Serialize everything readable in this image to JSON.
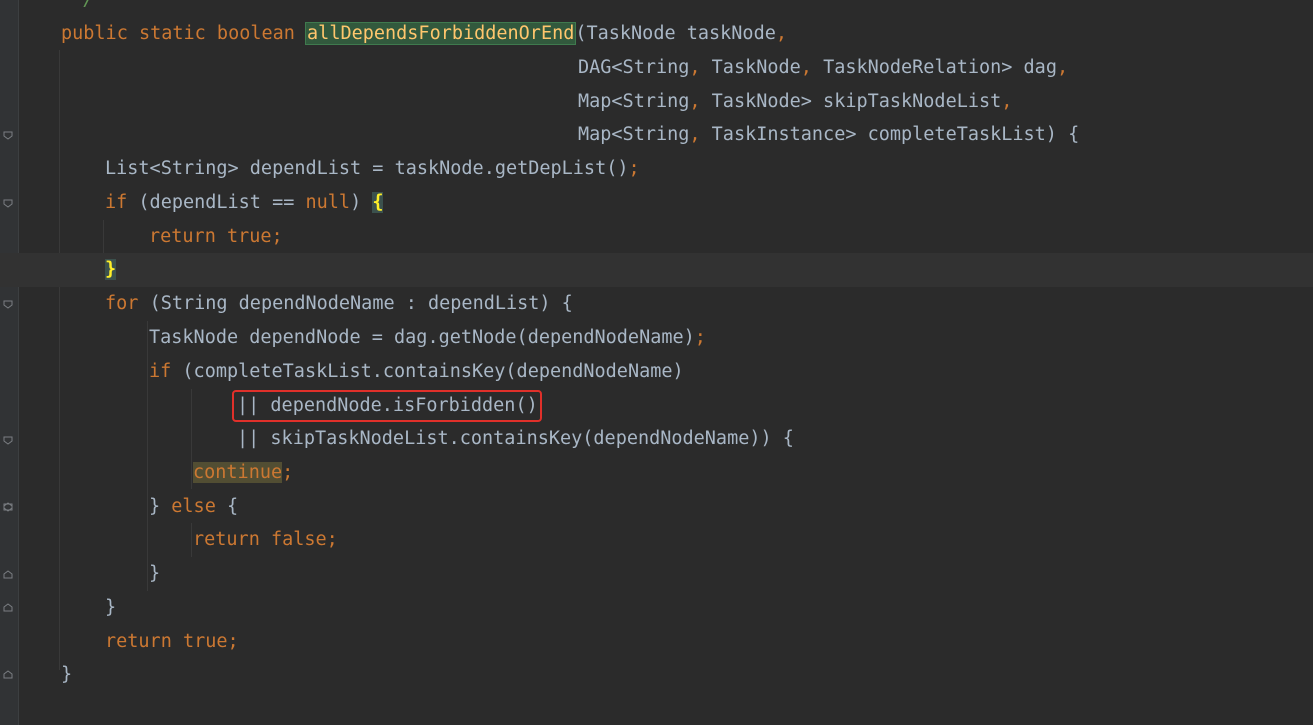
{
  "editor": {
    "background": "#2b2b2b",
    "lines": [
      {
        "tokens": [
          {
            "t": " */",
            "c": "comment"
          }
        ]
      },
      {
        "tokens": [
          {
            "t": "public static boolean ",
            "c": "kw"
          },
          {
            "t": "allDependsForbiddenOrEnd",
            "c": "fn hl-method"
          },
          {
            "t": "(TaskNode taskNode",
            "c": ""
          },
          {
            "t": ",",
            "c": "punct"
          }
        ]
      },
      {
        "tokens": [
          {
            "t": "DAG<String",
            "c": ""
          },
          {
            "t": ", ",
            "c": "punct"
          },
          {
            "t": "TaskNode",
            "c": ""
          },
          {
            "t": ", ",
            "c": "punct"
          },
          {
            "t": "TaskNodeRelation> dag",
            "c": ""
          },
          {
            "t": ",",
            "c": "punct"
          }
        ]
      },
      {
        "tokens": [
          {
            "t": "Map<String",
            "c": ""
          },
          {
            "t": ", ",
            "c": "punct"
          },
          {
            "t": "TaskNode> skipTaskNodeList",
            "c": ""
          },
          {
            "t": ",",
            "c": "punct"
          }
        ]
      },
      {
        "tokens": [
          {
            "t": "Map<String",
            "c": ""
          },
          {
            "t": ", ",
            "c": "punct"
          },
          {
            "t": "TaskInstance> completeTaskList) {",
            "c": ""
          }
        ]
      },
      {
        "tokens": [
          {
            "t": "List<String> dependList = taskNode.getDepList()",
            "c": ""
          },
          {
            "t": ";",
            "c": "punct"
          }
        ]
      },
      {
        "tokens": [
          {
            "t": "if ",
            "c": "kw"
          },
          {
            "t": "(dependList == ",
            "c": ""
          },
          {
            "t": "null",
            "c": "kw"
          },
          {
            "t": ") ",
            "c": ""
          },
          {
            "t": "{",
            "c": "hl-brace"
          }
        ]
      },
      {
        "tokens": [
          {
            "t": "return true;",
            "c": "kw"
          }
        ]
      },
      {
        "tokens": [
          {
            "t": "}",
            "c": "hl-brace"
          }
        ]
      },
      {
        "tokens": [
          {
            "t": "for ",
            "c": "kw"
          },
          {
            "t": "(String dependNodeName : dependList) {",
            "c": ""
          }
        ]
      },
      {
        "tokens": [
          {
            "t": "TaskNode dependNode = dag.getNode(dependNodeName)",
            "c": ""
          },
          {
            "t": ";",
            "c": "punct"
          }
        ]
      },
      {
        "tokens": [
          {
            "t": "if ",
            "c": "kw"
          },
          {
            "t": "(completeTaskList.containsKey(dependNodeName)",
            "c": ""
          }
        ]
      },
      {
        "tokens": [
          {
            "t": "|| dependNode.isForbidden()",
            "c": ""
          }
        ]
      },
      {
        "tokens": [
          {
            "t": "|| skipTaskNodeList.containsKey(dependNodeName)) {",
            "c": ""
          }
        ]
      },
      {
        "tokens": [
          {
            "t": "continue",
            "c": "kw hl-continue"
          },
          {
            "t": ";",
            "c": "punct"
          }
        ]
      },
      {
        "tokens": [
          {
            "t": "} ",
            "c": ""
          },
          {
            "t": "else ",
            "c": "kw"
          },
          {
            "t": "{",
            "c": ""
          }
        ]
      },
      {
        "tokens": [
          {
            "t": "return false;",
            "c": "kw"
          }
        ]
      },
      {
        "tokens": [
          {
            "t": "}",
            "c": ""
          }
        ]
      },
      {
        "tokens": [
          {
            "t": "}",
            "c": ""
          }
        ]
      },
      {
        "tokens": [
          {
            "t": "return true;",
            "c": "kw"
          }
        ]
      },
      {
        "tokens": [
          {
            "t": "}",
            "c": ""
          }
        ]
      }
    ]
  },
  "annotation": {
    "highlight_color": "#e0302a"
  }
}
